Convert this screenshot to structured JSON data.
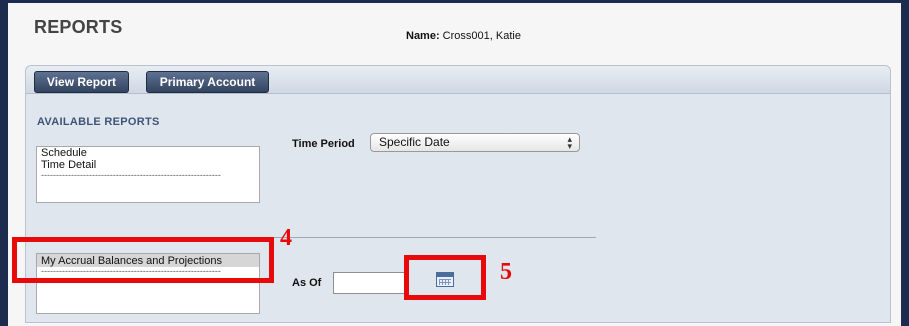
{
  "header": {
    "title": "REPORTS",
    "name_label": "Name:",
    "name_value": " Cross001, Katie"
  },
  "toolbar": {
    "view_report_label": "View Report",
    "primary_account_label": "Primary Account"
  },
  "available_reports": {
    "section_label": "AVAILABLE REPORTS",
    "list1": {
      "items": [
        "Schedule",
        "Time Detail"
      ],
      "separator": "------------------------------------------------------------"
    },
    "list2": {
      "items": [
        "My Accrual Balances and Projections"
      ],
      "separator": "------------------------------------------------------------"
    }
  },
  "filters": {
    "time_period_label": "Time Period",
    "time_period_value": "Specific Date",
    "as_of_label": "As Of",
    "as_of_value": ""
  },
  "annotations": {
    "label_4": "4",
    "label_5": "5",
    "color": "#e8090b"
  },
  "colors": {
    "frame": "#1d2b4f",
    "button": "#3e4f6c",
    "section_label": "#3f5477",
    "panel_bg": "#dfe6ee"
  },
  "icons": {
    "calendar": "calendar-icon",
    "select_arrows": "updown-arrows-icon"
  }
}
